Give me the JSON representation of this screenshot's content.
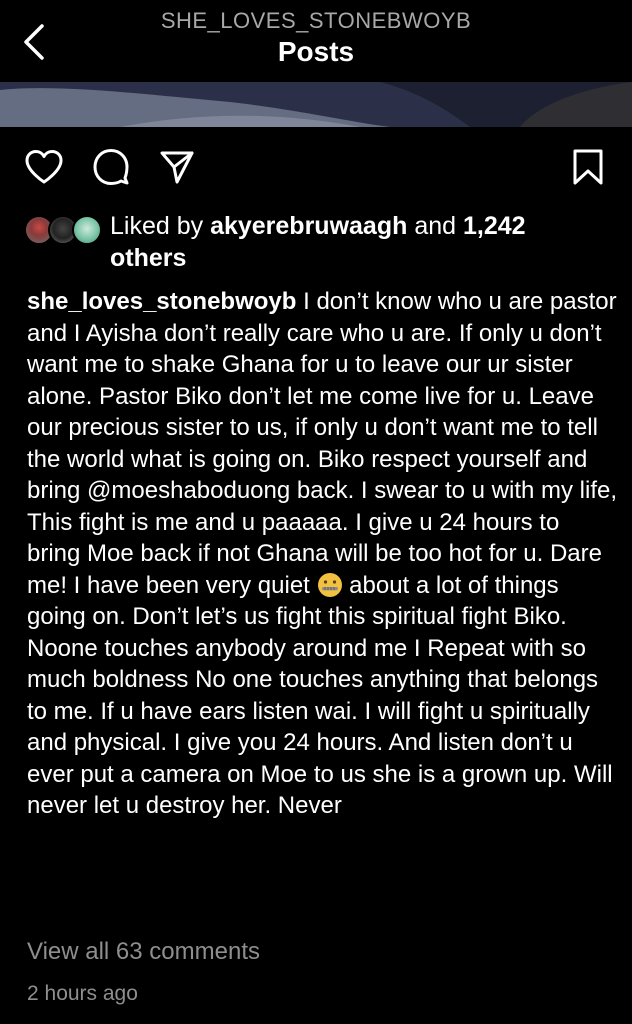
{
  "header": {
    "username": "SHE_LOVES_STONEBWOYB",
    "title": "Posts",
    "back_icon": "chevron-left-icon"
  },
  "actions": {
    "like_icon": "heart-icon",
    "comment_icon": "comment-icon",
    "share_icon": "send-icon",
    "save_icon": "bookmark-icon"
  },
  "likes": {
    "prefix": "Liked by ",
    "user": "akyerebruwaagh",
    "middle": " and ",
    "count": "1,242",
    "suffix": "others"
  },
  "caption": {
    "username": "she_loves_stonebwoyb",
    "text_part1": " I don’t know who u are pastor and I Ayisha don’t really care who u are. If only u don’t want me to shake Ghana for u to leave our ur sister alone. Pastor Biko don’t let me come live for u. Leave our precious sister to us, if only u don’t want me to tell the world what is going on. Biko respect yourself and bring ",
    "mention": "@moeshaboduong",
    "text_part2": "  back. I swear to u with my life, This fight is me and u paaaaa. I give u 24 hours to bring Moe back if not Ghana will be too hot for u. Dare me! I have been very quiet ",
    "emoji": "zipper-mouth-face-emoji",
    "text_part3": "  about a lot of things going on. Don’t let’s us fight this spiritual fight Biko. Noone touches anybody around me I Repeat with so much boldness No one touches anything that belongs to me. If u have ears listen wai. I will fight u spiritually and physical. I give you 24 hours. And listen don’t u ever put a camera on Moe to us she is a grown up. Will never let u destroy her. Never"
  },
  "comments": {
    "view_all": "View all 63 comments"
  },
  "timestamp": "2 hours ago",
  "colors": {
    "background": "#000000",
    "text": "#ffffff",
    "muted": "#8e8e8e",
    "header_username": "#a8a8a8"
  }
}
